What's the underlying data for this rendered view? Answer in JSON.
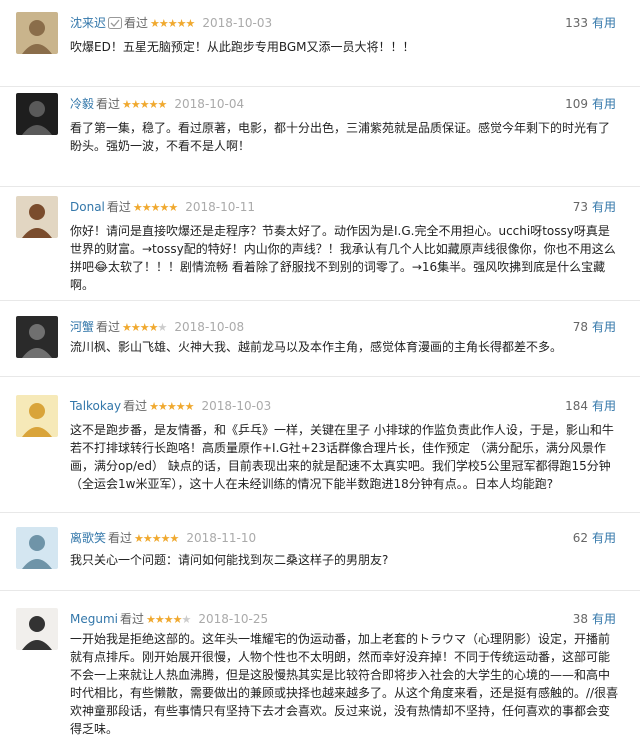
{
  "vote_suffix": "有用",
  "reviews": [
    {
      "user": "沈来迟",
      "status": "看过",
      "rating": 5,
      "date": "2018-10-03",
      "votes": "133",
      "text": "吹爆ED！五星无脑预定！从此跑步专用BGM又添一员大将！！！"
    },
    {
      "user": "冷毅",
      "status": "看过",
      "rating": 5,
      "date": "2018-10-04",
      "votes": "109",
      "text": "看了第一集，稳了。看过原著，电影，都十分出色，三浦紫苑就是品质保证。感觉今年剩下的时光有了盼头。强奶一波，不看不是人啊！"
    },
    {
      "user": "Donal",
      "status": "看过",
      "rating": 5,
      "date": "2018-10-11",
      "votes": "73",
      "text": "你好！请问是直接吹爆还是走程序？节奏太好了。动作因为是I.G.完全不用担心。ucchi呀tossy呀真是世界的财富。→tossy配的特好！内山你的声线？！我承认有几个人比如藏原声线很像你，你也不用这么拼吧😂太软了！！！剧情流畅 看着除了舒服找不到别的词零了。→16集半。强风吹拂到底是什么宝藏啊。"
    },
    {
      "user": "河蟹",
      "status": "看过",
      "rating": 4,
      "date": "2018-10-08",
      "votes": "78",
      "text": "流川枫、影山飞雄、火神大我、越前龙马以及本作主角，感觉体育漫画的主角长得都差不多。"
    },
    {
      "user": "Talkokay",
      "status": "看过",
      "rating": 5,
      "date": "2018-10-03",
      "votes": "184",
      "text": "这不是跑步番，是友情番，和《乒乓》一样，关键在里子 小排球的作监负责此作人设，于是，影山和牛若不打排球转行长跑咯！高质量原作+I.G社+23话群像合理片长，佳作预定 （满分配乐，满分风景作画，满分op/ed） 缺点的话，目前表现出来的就是配速不太真实吧。我们学校5公里冠军都得跑15分钟（全运会1w米亚军），这十人在未经训练的情况下能半数跑进18分钟有点。。日本人均能跑?"
    },
    {
      "user": "离歌笑",
      "status": "看过",
      "rating": 5,
      "date": "2018-11-10",
      "votes": "62",
      "text": "我只关心一个问题：请问如何能找到灰二桑这样子的男朋友?"
    },
    {
      "user": "Megumi",
      "status": "看过",
      "rating": 4,
      "date": "2018-10-25",
      "votes": "38",
      "text": "一开始我是拒绝这部的。这年头一堆耀宅的伪运动番，加上老套的トラウマ（心理阴影）设定，开播前就有点排斥。刚开始展开很慢，人物个性也不太明朗，然而幸好没弃掉！不同于传统运动番，这部可能不会一上来就让人热血沸腾，但是这股慢热其实是比较符合即将步入社会的大学生的心境的——和高中时代相比，有些懒散，需要做出的兼顾或抉择也越来越多了。从这个角度来看，还是挺有感触的。//很喜欢神童那段话，有些事情只有坚持下去才会喜欢。反过来说，没有热情却不坚持，任何喜欢的事都会变得乏味。"
    }
  ]
}
